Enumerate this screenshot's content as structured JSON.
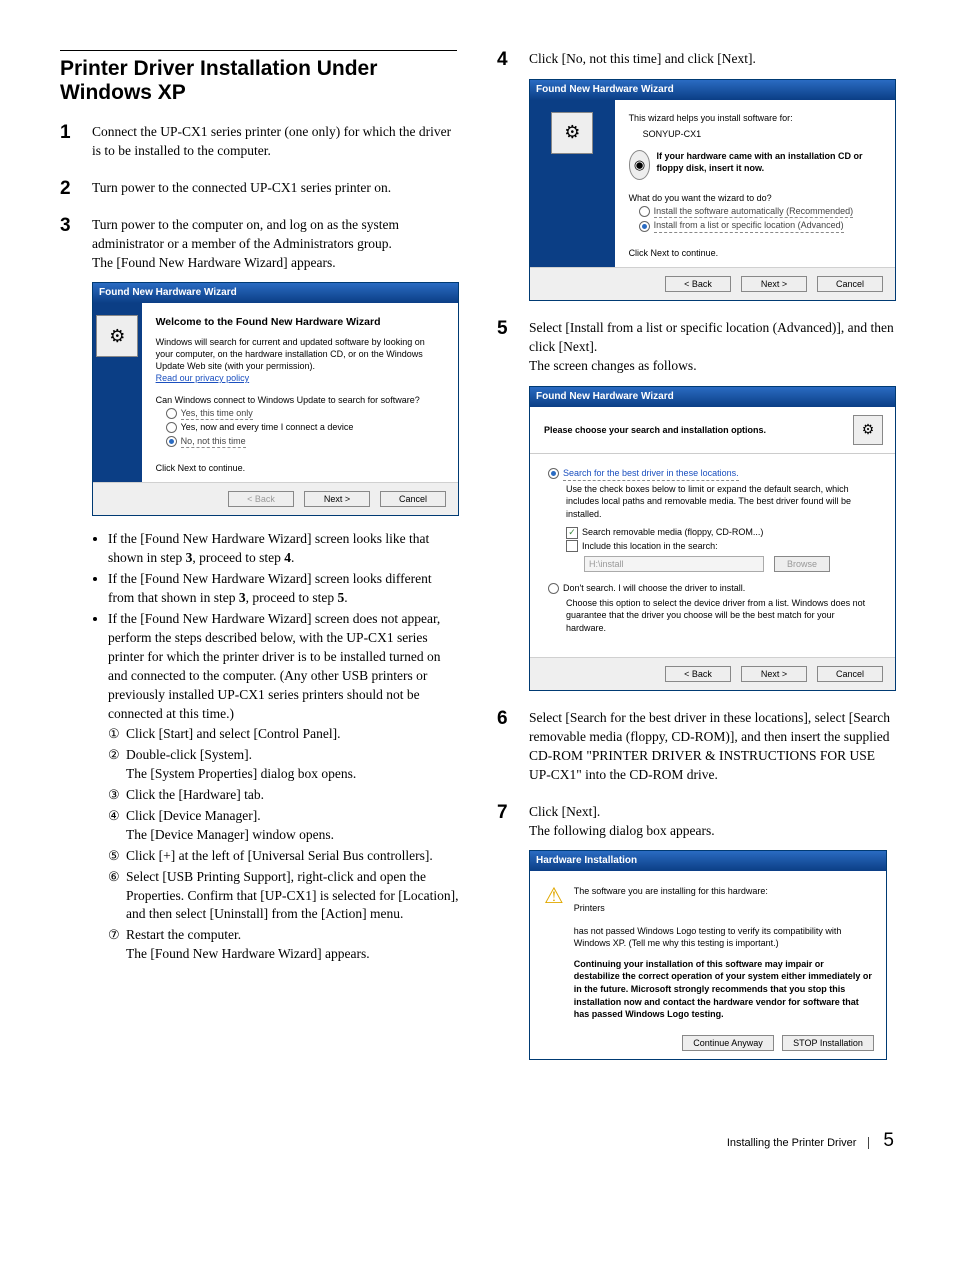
{
  "left": {
    "heading": "Printer Driver Installation Under Windows XP",
    "steps": {
      "s1": "Connect the UP-CX1 series printer (one only) for which the driver is to be installed to the computer.",
      "s2": "Turn power to the connected UP-CX1 series printer on.",
      "s3a": "Turn power to the computer on, and log on as the system administrator or a member of the Administrators group.",
      "s3b": "The [Found New Hardware Wizard] appears."
    },
    "wizard1": {
      "title": "Found New Hardware Wizard",
      "heading": "Welcome to the Found New Hardware Wizard",
      "p1": "Windows will search for current and updated software by looking on your computer, on the hardware installation CD, or on the Windows Update Web site (with your permission).",
      "policy": "Read our privacy policy",
      "q": "Can Windows connect to Windows Update to search for software?",
      "opt1": "Yes, this time only",
      "opt2": "Yes, now and every time I connect a device",
      "opt3": "No, not this time",
      "cont": "Click Next to continue.",
      "back": "< Back",
      "next": "Next >",
      "cancel": "Cancel"
    },
    "bullets": {
      "b1a": "If the [Found New Hardware Wizard] screen looks like that shown in step ",
      "b1b": ", proceed to step ",
      "n3": "3",
      "n4": "4",
      "b2a": "If the [Found New Hardware Wizard] screen looks different from that shown in step ",
      "b2b": ", proceed to step ",
      "n5": "5",
      "b3": "If the [Found New Hardware Wizard] screen does not appear, perform the steps described below, with the UP-CX1 series printer for which the printer driver is to be installed turned on and connected to the computer. (Any other USB printers or previously installed UP-CX1 series printers should not be connected at this time.)"
    },
    "subs": {
      "s1": "Click [Start] and select [Control Panel].",
      "s2a": "Double-click [System].",
      "s2b": "The [System Properties] dialog box opens.",
      "s3": "Click the [Hardware] tab.",
      "s4a": "Click [Device Manager].",
      "s4b": "The [Device Manager] window opens.",
      "s5": "Click [+] at the left of [Universal Serial Bus controllers].",
      "s6": "Select [USB Printing Support], right-click and open the Properties. Confirm that [UP-CX1] is selected for [Location], and then select [Uninstall] from the [Action] menu.",
      "s7a": "Restart the computer.",
      "s7b": "The [Found New Hardware Wizard] appears."
    }
  },
  "right": {
    "s4": "Click [No, not this time] and click [Next].",
    "wizard2": {
      "title": "Found New Hardware Wizard",
      "intro": "This wizard helps you install software for:",
      "device": "SONYUP-CX1",
      "cd": "If your hardware came with an installation CD or floppy disk, insert it now.",
      "q": "What do you want the wizard to do?",
      "opt1": "Install the software automatically (Recommended)",
      "opt2": "Install from a list or specific location (Advanced)",
      "cont": "Click Next to continue.",
      "back": "< Back",
      "next": "Next >",
      "cancel": "Cancel"
    },
    "s5a": "Select [Install from a list or specific location (Advanced)], and then click [Next].",
    "s5b": "The screen changes as follows.",
    "wizard3": {
      "title": "Found New Hardware Wizard",
      "header": "Please choose your search and installation options.",
      "opt1": "Search for the best driver in these locations.",
      "opt1desc": "Use the check boxes below to limit or expand the default search, which includes local paths and removable media. The best driver found will be installed.",
      "chk1": "Search removable media (floppy, CD-ROM...)",
      "chk2": "Include this location in the search:",
      "path": "H:\\install",
      "browse": "Browse",
      "opt2": "Don't search. I will choose the driver to install.",
      "opt2desc": "Choose this option to select the device driver from a list. Windows does not guarantee that the driver you choose will be the best match for your hardware.",
      "back": "< Back",
      "next": "Next >",
      "cancel": "Cancel"
    },
    "s6": "Select [Search for the best driver in these locations], select [Search removable media (floppy, CD-ROM)], and then insert the supplied CD-ROM \"PRINTER DRIVER & INSTRUCTIONS FOR USE UP-CX1\" into the CD-ROM drive.",
    "s7a": "Click [Next].",
    "s7b": "The following dialog box appears.",
    "alert": {
      "title": "Hardware Installation",
      "line1": "The software you are installing for this hardware:",
      "line2": "Printers",
      "line3a": "has not passed Windows Logo testing to verify its compatibility with Windows XP. (",
      "link": "Tell me why this testing is important.",
      "line3b": ")",
      "bold": "Continuing your installation of this software may impair or destabilize the correct operation of your system either immediately or in the future. Microsoft strongly recommends that you stop this installation now and contact the hardware vendor for software that has passed Windows Logo testing.",
      "cont": "Continue Anyway",
      "stop": "STOP Installation"
    }
  },
  "footer": {
    "label": "Installing the Printer Driver",
    "page": "5"
  }
}
